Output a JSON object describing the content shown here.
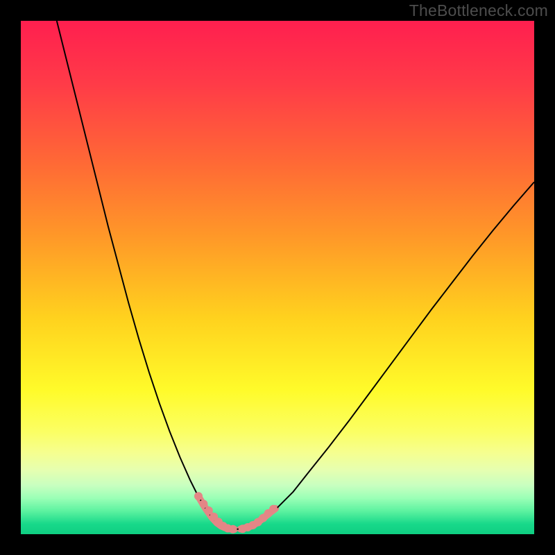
{
  "watermark": "TheBottleneck.com",
  "chart_data": {
    "type": "line",
    "title": "",
    "xlabel": "",
    "ylabel": "",
    "xlim": [
      0,
      100
    ],
    "ylim": [
      0,
      100
    ],
    "background_gradient_stops": [
      {
        "offset": 0.0,
        "color": "#ff1f4f"
      },
      {
        "offset": 0.12,
        "color": "#ff3a48"
      },
      {
        "offset": 0.28,
        "color": "#ff6a35"
      },
      {
        "offset": 0.42,
        "color": "#ff9828"
      },
      {
        "offset": 0.58,
        "color": "#ffd21e"
      },
      {
        "offset": 0.72,
        "color": "#fffb2a"
      },
      {
        "offset": 0.8,
        "color": "#fbff63"
      },
      {
        "offset": 0.84,
        "color": "#f6ff8e"
      },
      {
        "offset": 0.875,
        "color": "#e6ffb0"
      },
      {
        "offset": 0.905,
        "color": "#c8ffc0"
      },
      {
        "offset": 0.93,
        "color": "#9affb6"
      },
      {
        "offset": 0.955,
        "color": "#5cf2a0"
      },
      {
        "offset": 0.98,
        "color": "#18d98a"
      },
      {
        "offset": 1.0,
        "color": "#0fce82"
      }
    ],
    "series": [
      {
        "name": "left-curve",
        "stroke": "#000000",
        "stroke_width": 2,
        "x": [
          7,
          9,
          11,
          13,
          15,
          17,
          19,
          21,
          23,
          25,
          27,
          29,
          31,
          33,
          34.5,
          36,
          37.2,
          38.2
        ],
        "y": [
          100,
          92,
          84,
          76,
          68,
          60,
          52.5,
          45,
          38,
          31.5,
          25.5,
          20,
          15,
          10.5,
          7.5,
          5,
          3.3,
          2.2
        ]
      },
      {
        "name": "right-curve",
        "stroke": "#000000",
        "stroke_width": 2,
        "x": [
          46,
          48,
          50,
          53,
          56,
          60,
          64,
          68,
          72,
          76,
          80,
          84,
          88,
          92,
          96,
          100
        ],
        "y": [
          2.2,
          3.5,
          5.2,
          8.2,
          12,
          17,
          22.2,
          27.6,
          33,
          38.4,
          43.8,
          49,
          54.2,
          59.2,
          64,
          68.6
        ]
      },
      {
        "name": "floor-notch",
        "stroke": "#000000",
        "stroke_width": 2.2,
        "x": [
          38.2,
          39.0,
          39.8,
          40.6,
          41.6,
          42.8,
          44.2,
          45.2,
          46.0
        ],
        "y": [
          2.2,
          1.6,
          1.25,
          1.05,
          0.95,
          1.02,
          1.35,
          1.7,
          2.2
        ]
      },
      {
        "name": "left-pink-overlay",
        "stroke": "#e48686",
        "stroke_width": 10,
        "linecap": "round",
        "x": [
          34.5,
          36,
          37.2,
          38.2,
          39.0,
          39.8,
          40.6,
          41.6
        ],
        "y": [
          7.5,
          5,
          3.3,
          2.2,
          1.6,
          1.25,
          1.05,
          0.95
        ]
      },
      {
        "name": "right-pink-overlay",
        "stroke": "#e48686",
        "stroke_width": 10,
        "linecap": "round",
        "x": [
          42.8,
          44.2,
          45.2,
          46.0,
          47.2,
          48.4,
          49.6
        ],
        "y": [
          1.02,
          1.35,
          1.7,
          2.2,
          3.1,
          4.1,
          5.0
        ]
      },
      {
        "name": "left-pink-dots",
        "type": "scatter",
        "fill": "#e48686",
        "r": 6,
        "x": [
          34.6,
          35.6,
          36.6,
          37.6,
          38.5,
          39.4,
          40.3,
          41.3
        ],
        "y": [
          7.4,
          5.9,
          4.6,
          3.4,
          2.4,
          1.6,
          1.15,
          0.98
        ]
      },
      {
        "name": "right-pink-dots",
        "type": "scatter",
        "fill": "#e48686",
        "r": 6,
        "x": [
          43.2,
          44.2,
          45.2,
          46.2,
          47.2,
          48.2,
          49.2
        ],
        "y": [
          1.05,
          1.35,
          1.75,
          2.35,
          3.15,
          4.05,
          4.9
        ]
      }
    ]
  }
}
